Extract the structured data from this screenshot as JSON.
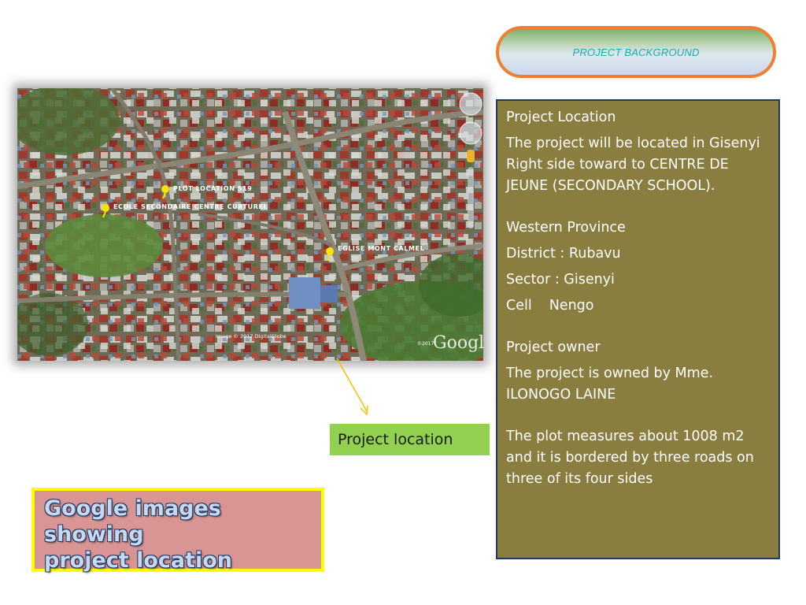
{
  "header": {
    "title": "PROJECT BACKGROUND"
  },
  "panel": {
    "location_heading": "Project Location",
    "location_text": "The project  will be located in Gisenyi Right side toward to CENTRE DE JEUNE (SECONDARY SCHOOL).",
    "province": "Western Province",
    "district": "District : Rubavu",
    "sector": "Sector : Gisenyi",
    "cell_label": "Cell",
    "cell_value": "Nengo",
    "owner_heading": "Project owner",
    "owner_text": "The project is owned by Mme. ILONOGO LAINE",
    "plot_text": "The plot measures about 1008 m2 and it is bordered by three roads  on three of its four sides"
  },
  "map": {
    "labels": {
      "plot": "PLOT LOCATION 519",
      "school": "ECOLE SECONDAIRE CENTRE CURTUREL",
      "church": "EGLISE MONT CALMEL"
    },
    "credit": "Image © 2017 DigitalGlobe",
    "logo": "Google",
    "logo_year": "©2017"
  },
  "location_label": "Project location",
  "caption": {
    "line1": "Google images showing",
    "line2": "project location"
  },
  "colors": {
    "panel_bg": "#8a7d40",
    "panel_border": "#1f3864",
    "pill_border": "#f08030",
    "pill_text": "#1aa9b8",
    "label_bg": "#92d050",
    "caption_bg": "#d99594",
    "caption_border": "#ffff00",
    "caption_text": "#c6d9f1",
    "pin": "#f2e600",
    "arrow": "#f2c200"
  }
}
